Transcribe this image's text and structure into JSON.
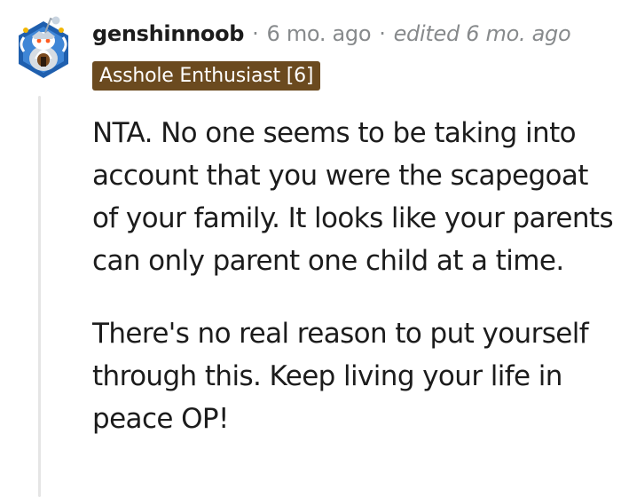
{
  "comment": {
    "author": "genshinnoob",
    "separator": "·",
    "age": "6 mo. ago",
    "edited": "edited 6 mo. ago",
    "flair": "Asshole Enthusiast [6]",
    "flair_color": "#6b4a1f",
    "avatar_icon": "reddit-snoovatar-icon",
    "paragraphs": [
      "NTA. No one seems to be taking into account that you were the scapegoat of your family. It looks like your parents can only parent one child at a time.",
      "There's no real reason to put yourself through this. Keep living your life in peace OP!"
    ]
  },
  "colors": {
    "text": "#1c1c1c",
    "meta": "#878a8c",
    "thread_line": "#e5e5e5",
    "avatar_blue": "#1f5fae"
  }
}
